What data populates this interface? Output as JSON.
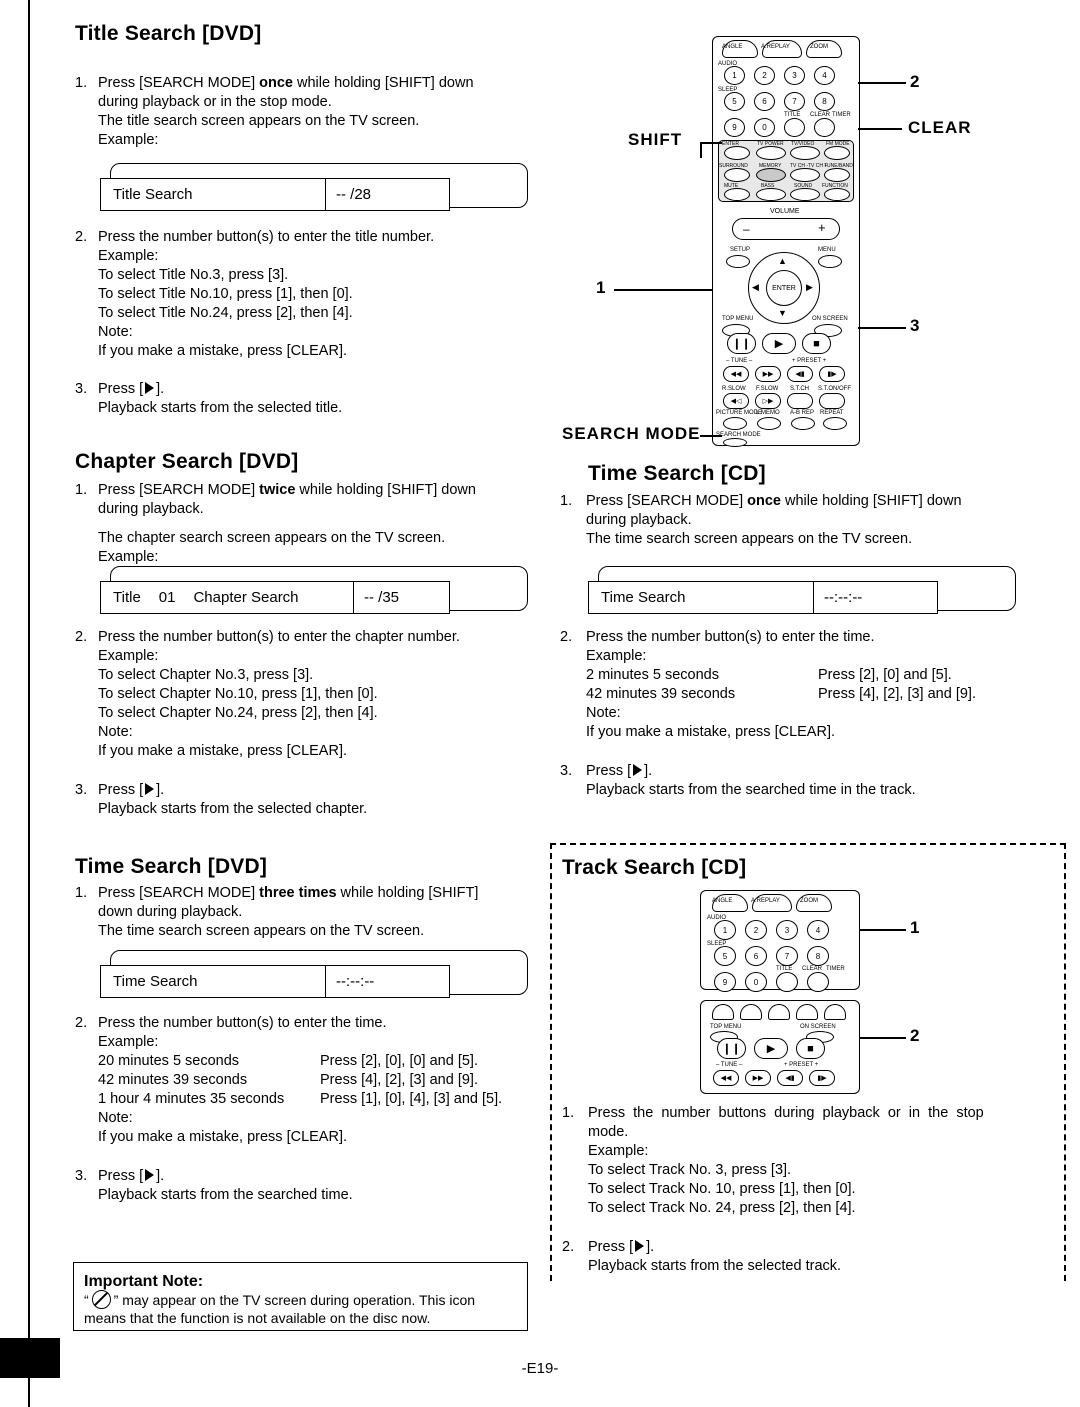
{
  "page": {
    "footer": "-E19-"
  },
  "sections": {
    "title_search_dvd": {
      "heading": "Title Search [DVD]",
      "step1_num": "1.",
      "step1_a": "Press [SEARCH MODE] ",
      "step1_bold": "once",
      "step1_b": " while holding [SHIFT] down",
      "step1_c": "during playback or in the stop mode.",
      "step1_d": "The title search screen appears on the TV screen.",
      "step1_e": "Example:",
      "osd_label": "Title Search",
      "osd_value": "--  /28",
      "step2_num": "2.",
      "step2_a": "Press the number button(s) to enter the title number.",
      "step2_b": "Example:",
      "step2_c": "To select Title No.3, press [3].",
      "step2_d": "To select Title No.10, press [1], then [0].",
      "step2_e": "To select Title No.24, press [2], then [4].",
      "step2_f": "Note:",
      "step2_g": "If you make a mistake, press [CLEAR].",
      "step3_num": "3.",
      "step3_a": "Press [",
      "step3_b": "].",
      "step3_c": "Playback starts from the selected title."
    },
    "chapter_search_dvd": {
      "heading": "Chapter Search [DVD]",
      "step1_num": "1.",
      "step1_a": "Press [SEARCH MODE] ",
      "step1_bold": "twice",
      "step1_b": " while holding [SHIFT] down",
      "step1_c": "during playback.",
      "step1_d": "The chapter search screen appears on the TV screen.",
      "step1_e": "Example:",
      "osd_label_title": "Title",
      "osd_label_num": "01",
      "osd_label_chapter": "Chapter Search",
      "osd_value": "--  /35",
      "step2_num": "2.",
      "step2_a": "Press the number button(s) to enter the chapter number.",
      "step2_b": "Example:",
      "step2_c": "To select Chapter No.3, press [3].",
      "step2_d": "To select Chapter No.10, press [1], then [0].",
      "step2_e": "To select Chapter No.24, press [2], then [4].",
      "step2_f": "Note:",
      "step2_g": "If you make a mistake, press [CLEAR].",
      "step3_num": "3.",
      "step3_a": "Press [",
      "step3_b": "].",
      "step3_c": "Playback starts from the selected chapter."
    },
    "time_search_dvd": {
      "heading": "Time Search [DVD]",
      "step1_num": "1.",
      "step1_a": "Press [SEARCH MODE] ",
      "step1_bold": "three times",
      "step1_b": " while holding [SHIFT]",
      "step1_c": "down during playback.",
      "step1_d": "The time search screen appears on the TV screen.",
      "osd_label": "Time Search",
      "osd_value": "--:--:--",
      "step2_num": "2.",
      "step2_a": "Press the number button(s) to enter the time.",
      "step2_b": "Example:",
      "examples": [
        {
          "left": "20 minutes 5 seconds",
          "right": "Press [2], [0], [0] and [5]."
        },
        {
          "left": "42 minutes 39 seconds",
          "right": "Press [4], [2], [3] and [9]."
        },
        {
          "left": "1 hour 4 minutes 35 seconds",
          "right": "Press [1], [0], [4], [3] and [5]."
        }
      ],
      "step2_f": "Note:",
      "step2_g": "If you make a mistake, press [CLEAR].",
      "step3_num": "3.",
      "step3_a": "Press [",
      "step3_b": "].",
      "step3_c": "Playback starts from the searched time."
    },
    "time_search_cd": {
      "heading": "Time Search [CD]",
      "step1_num": "1.",
      "step1_a": "Press [SEARCH MODE] ",
      "step1_bold": "once",
      "step1_b": " while holding [SHIFT] down",
      "step1_c": "during playback.",
      "step1_d": "The time search screen appears on the TV screen.",
      "osd_label": "Time Search",
      "osd_value": "--:--:--",
      "step2_num": "2.",
      "step2_a": "Press the number button(s) to enter the time.",
      "step2_b": "Example:",
      "examples": [
        {
          "left": "2 minutes 5 seconds",
          "right": "Press [2], [0] and [5]."
        },
        {
          "left": "42 minutes 39 seconds",
          "right": "Press [4], [2], [3] and [9]."
        }
      ],
      "step2_f": "Note:",
      "step2_g": "If you make a mistake, press [CLEAR].",
      "step3_num": "3.",
      "step3_a": "Press [",
      "step3_b": "].",
      "step3_c": "Playback starts from the searched time in the track."
    },
    "track_search_cd": {
      "heading": "Track Search [CD]",
      "step1_num": "1.",
      "step1_a": "Press  the  number  buttons  during  playback  or  in  the  stop",
      "step1_b": "mode.",
      "step1_c": "Example:",
      "step1_d": "To select Track No. 3, press [3].",
      "step1_e": "To select Track No. 10, press [1], then [0].",
      "step1_f": "To select Track No. 24, press [2], then [4].",
      "step2_num": "2.",
      "step2_a": "Press [",
      "step2_b": "].",
      "step2_c": "Playback starts from the selected track."
    },
    "important_note": {
      "heading": "Important Note:",
      "line1_a": "“",
      "line1_b": "” may appear on the TV screen during operation. This icon",
      "line2": "means that the function is not available on the disc now."
    }
  },
  "callouts": {
    "shift": "SHIFT",
    "clear": "CLEAR",
    "search_mode": "SEARCH MODE",
    "n1": "1",
    "n2": "2",
    "n3": "3",
    "track_n1": "1",
    "track_n2": "2"
  },
  "remote_top": {
    "row_top_labels": [
      "ANGLE",
      "A.REPLAY",
      "ZOOM"
    ],
    "numbers": [
      "1",
      "2",
      "3",
      "4",
      "5",
      "6",
      "7",
      "8",
      "9",
      "0"
    ],
    "left_labels": [
      "AUDIO",
      "SLEEP"
    ],
    "mid_labels": [
      "TITLE",
      "CLEAR",
      "TIMER"
    ],
    "row_enter": [
      "ENTER",
      "TV POWER",
      "TV/VIDEO",
      "FM MODE"
    ],
    "row_surround": [
      "SURROUND",
      "MEMORY",
      "TV CH -",
      "TV CH +",
      "TUNE/BAND"
    ],
    "row_mute": [
      "MUTE",
      "BASS",
      "SOUND",
      "FUNCTION"
    ],
    "volume": "VOLUME",
    "vol_minus": "–",
    "vol_plus": "+",
    "setup": "SETUP",
    "menu": "MENU",
    "enter": "ENTER",
    "top_menu": "TOP MENU",
    "on_screen": "ON SCREEN",
    "tune_minus": "– TUNE –",
    "preset_plus": "+ PRESET +",
    "row_slow": [
      "R.SLOW",
      "F.SLOW",
      "S.T.CH",
      "S.T.ON/OFF"
    ],
    "row_mode": [
      "PICTURE MODE",
      "L.MEMO",
      "A-B REP",
      "REPEAT"
    ],
    "search_mode_btn": "SEARCH MODE"
  },
  "remote_bottom": {
    "row_top_labels": [
      "ANGLE",
      "A.REPLAY",
      "ZOOM"
    ],
    "numbers": [
      "1",
      "2",
      "3",
      "4",
      "5",
      "6",
      "7",
      "8",
      "9",
      "0"
    ],
    "left_labels": [
      "AUDIO",
      "SLEEP"
    ],
    "mid_labels": [
      "TITLE",
      "CLEAR",
      "TIMER"
    ],
    "top_menu": "TOP MENU",
    "on_screen": "ON SCREEN",
    "tune_minus": "– TUNE –",
    "preset_plus": "+ PRESET +"
  }
}
